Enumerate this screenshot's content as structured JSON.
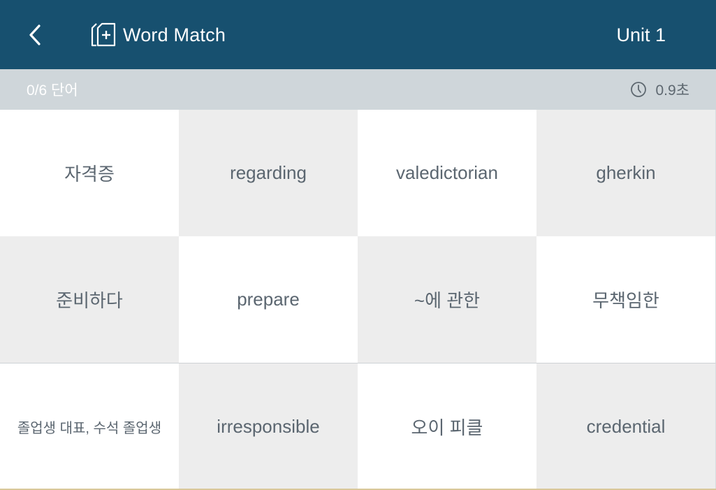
{
  "header": {
    "back_icon": "chevron-left-icon",
    "title_icon": "card-add-icon",
    "title": "Word Match",
    "unit": "Unit 1"
  },
  "status": {
    "count": "0/6 단어",
    "timer_icon": "clock-icon",
    "timer": "0.9초"
  },
  "cards": [
    "자격증",
    "regarding",
    "valedictorian",
    "gherkin",
    "준비하다",
    "prepare",
    "~에 관한",
    "무책임한",
    "졸업생 대표, 수석 졸업생",
    "irresponsible",
    "오이 피클",
    "credential"
  ],
  "colors": {
    "header_bg": "#17506f",
    "statusbar_bg": "#cfd6da",
    "card_light": "#ffffff",
    "card_dark": "#ededed",
    "card_text": "#5b6670"
  }
}
